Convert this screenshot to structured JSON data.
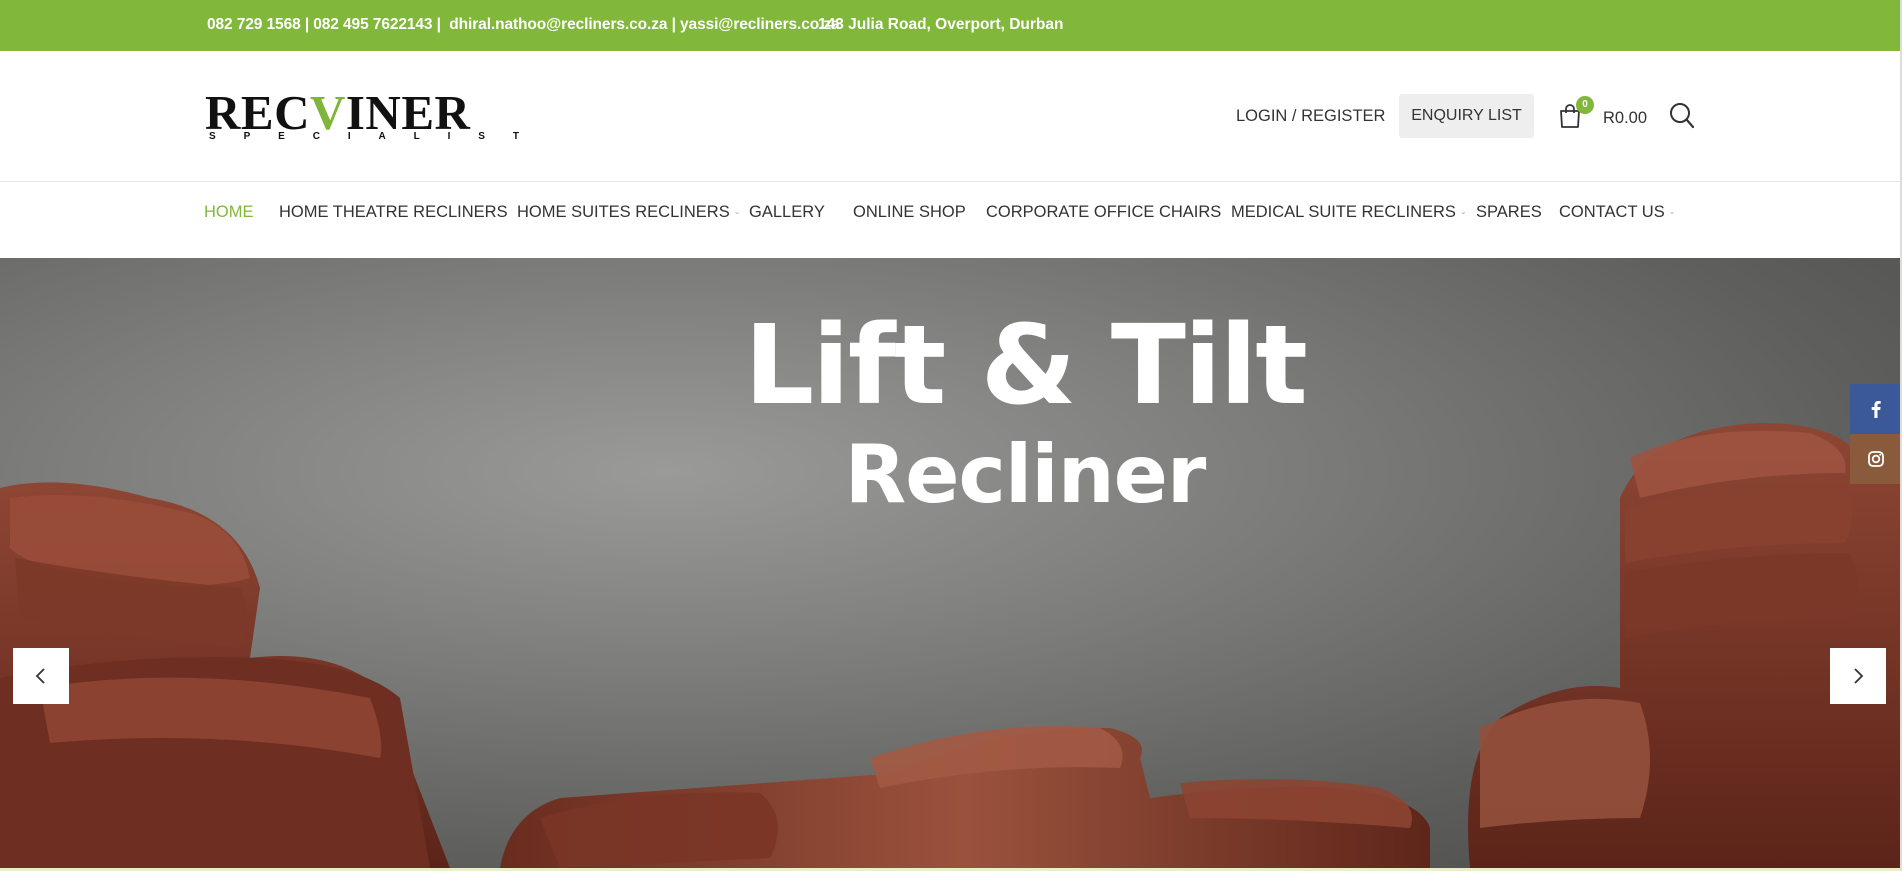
{
  "topbar": {
    "contact": "082 729 1568 | 082 495 7622143 |  dhiral.nathoo@recliners.co.za | yassi@recliners.co.za",
    "address": "143 Julia Road, Overport, Durban",
    "bg_color": "#81b73a"
  },
  "header": {
    "logo_text_pre": "REC",
    "logo_text_v": "V",
    "logo_text_post": "INER",
    "logo_sub": [
      "S",
      "P",
      "E",
      "C",
      "I",
      "A",
      "L",
      "I",
      "S",
      "T"
    ],
    "login_label": "LOGIN / REGISTER",
    "enquiry_label": "ENQUIRY LIST",
    "cart_count": "0",
    "cart_total": "R0.00",
    "accent_color": "#81b73a"
  },
  "nav": {
    "items": [
      {
        "label": "HOME",
        "active": true,
        "dropdown": false
      },
      {
        "label": "HOME THEATRE RECLINERS",
        "active": false,
        "dropdown": false
      },
      {
        "label": "HOME SUITES RECLINERS",
        "active": false,
        "dropdown": true
      },
      {
        "label": "GALLERY",
        "active": false,
        "dropdown": false
      },
      {
        "label": "ONLINE SHOP",
        "active": false,
        "dropdown": false
      },
      {
        "label": "CORPORATE OFFICE CHAIRS",
        "active": false,
        "dropdown": false
      },
      {
        "label": "MEDICAL SUITE RECLINERS",
        "active": false,
        "dropdown": true
      },
      {
        "label": "SPARES",
        "active": false,
        "dropdown": false
      },
      {
        "label": "CONTACT US",
        "active": false,
        "dropdown": true
      }
    ]
  },
  "hero": {
    "title": "Lift & Tilt",
    "subtitle": "Recliner",
    "prev_icon": "chevron-left-icon",
    "next_icon": "chevron-right-icon"
  },
  "social": {
    "items": [
      {
        "icon": "facebook-icon",
        "color": "#3b5998"
      },
      {
        "icon": "instagram-icon",
        "color": "#8a5a3d"
      }
    ]
  }
}
